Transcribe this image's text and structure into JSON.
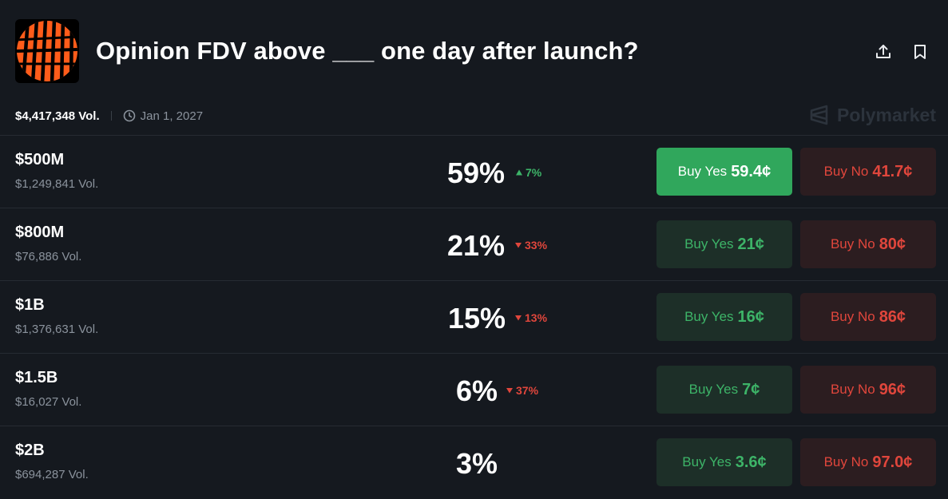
{
  "header": {
    "title": "Opinion FDV above ___ one day after launch?",
    "logo_icon": "opinion-logo",
    "share_icon": "share-upload-icon",
    "bookmark_icon": "bookmark-icon"
  },
  "meta": {
    "volume": "$4,417,348 Vol.",
    "date": "Jan 1, 2027",
    "brand": "Polymarket"
  },
  "colors": {
    "background": "#15191f",
    "yes_active": "#30a75c",
    "yes_bg": "#1d2f28",
    "yes_text": "#3db468",
    "no_bg": "#2c1d20",
    "no_text": "#e0463c",
    "muted": "#8b939d"
  },
  "outcomes": [
    {
      "label": "$500M",
      "volume": "$1,249,841 Vol.",
      "percent": "59%",
      "change": "7%",
      "direction": "up",
      "yes_text": "Buy Yes",
      "yes_price": "59.4¢",
      "no_text": "Buy No",
      "no_price": "41.7¢",
      "yes_active": true
    },
    {
      "label": "$800M",
      "volume": "$76,886 Vol.",
      "percent": "21%",
      "change": "33%",
      "direction": "down",
      "yes_text": "Buy Yes",
      "yes_price": "21¢",
      "no_text": "Buy No",
      "no_price": "80¢",
      "yes_active": false
    },
    {
      "label": "$1B",
      "volume": "$1,376,631 Vol.",
      "percent": "15%",
      "change": "13%",
      "direction": "down",
      "yes_text": "Buy Yes",
      "yes_price": "16¢",
      "no_text": "Buy No",
      "no_price": "86¢",
      "yes_active": false
    },
    {
      "label": "$1.5B",
      "volume": "$16,027 Vol.",
      "percent": "6%",
      "change": "37%",
      "direction": "down",
      "yes_text": "Buy Yes",
      "yes_price": "7¢",
      "no_text": "Buy No",
      "no_price": "96¢",
      "yes_active": false
    },
    {
      "label": "$2B",
      "volume": "$694,287 Vol.",
      "percent": "3%",
      "change": "",
      "direction": "none",
      "yes_text": "Buy Yes",
      "yes_price": "3.6¢",
      "no_text": "Buy No",
      "no_price": "97.0¢",
      "yes_active": false
    }
  ]
}
